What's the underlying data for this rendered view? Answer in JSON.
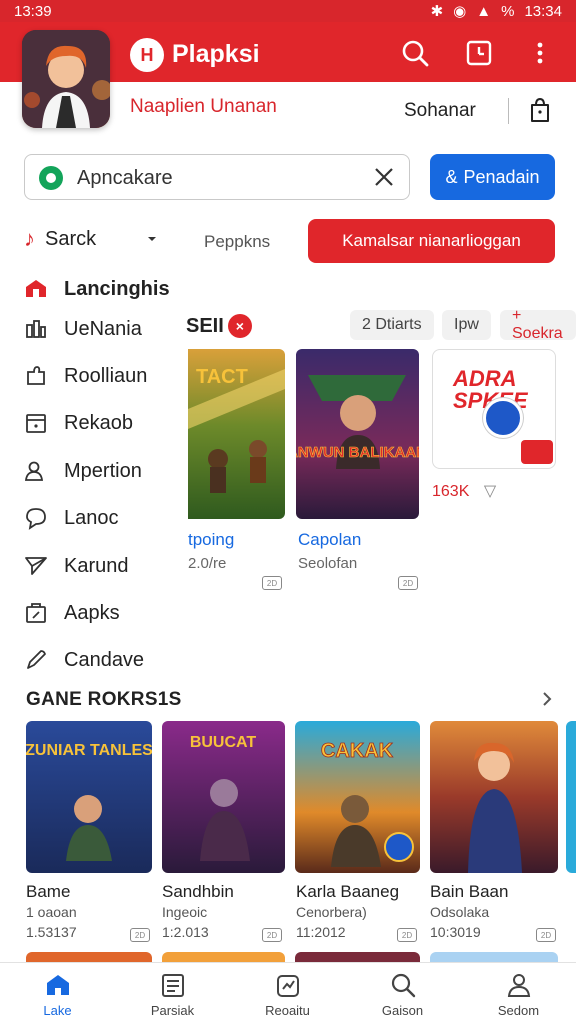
{
  "status_bar": {
    "time_left": "13:39",
    "battery": "%",
    "time_right": "13:34"
  },
  "app": {
    "title": "Plapksi",
    "logo_letter": "H",
    "subtitle": "Naaplien Unanan"
  },
  "header": {
    "sort_label": "Sohanar"
  },
  "search": {
    "value": "Apncakare",
    "button_label": "Penadain",
    "button_prefix": "&"
  },
  "filters": {
    "primary": "Sarck",
    "secondary": "Peppkns",
    "red_button": "Kamalsar nianarlioggan"
  },
  "sidebar": {
    "items": [
      {
        "label": "Lancinghis",
        "icon": "home-icon"
      },
      {
        "label": "UeNania",
        "icon": "chart-icon"
      },
      {
        "label": "Roolliaun",
        "icon": "puzzle-icon"
      },
      {
        "label": "Rekaob",
        "icon": "calendar-icon"
      },
      {
        "label": "Mpertion",
        "icon": "user-icon"
      },
      {
        "label": "Lanoc",
        "icon": "chat-icon"
      },
      {
        "label": "Karund",
        "icon": "send-icon"
      },
      {
        "label": "Aapks",
        "icon": "apps-icon"
      },
      {
        "label": "Candave",
        "icon": "pen-icon"
      }
    ]
  },
  "section": {
    "title": "SEII",
    "badge": "×",
    "chips": [
      "2 Dtiarts",
      "Ipw",
      "+ Soekra"
    ],
    "cards": [
      {
        "title": "tpoing",
        "sub": "2.0/re",
        "badge": "2D",
        "art_title": "TACT"
      },
      {
        "title": "Capolan",
        "sub": "Seolofan",
        "badge": "2D",
        "art_title": "ANWUN BALIKAAN"
      }
    ],
    "spike": {
      "art_title": "ADRA SPKEE",
      "count": "163K"
    }
  },
  "games": {
    "title": "GANE ROKRS1S",
    "items": [
      {
        "title": "Bame",
        "sub": "1 oaoan",
        "num": "1.53137",
        "badge": "2D",
        "art_title": "ZUNIAR TANLES"
      },
      {
        "title": "Sandhbin",
        "sub": "Ingeoic",
        "num": "1:2.013",
        "badge": "2D",
        "art_title": "BUUCAT"
      },
      {
        "title": "Karla Baaneg",
        "sub": "Cenorbera)",
        "num": "11:2012",
        "badge": "2D",
        "art_title": "CAKAK"
      },
      {
        "title": "Bain Baan",
        "sub": "Odsolaka",
        "num": "10:3019",
        "badge": "2D",
        "art_title": ""
      }
    ]
  },
  "bottom_nav": {
    "tabs": [
      {
        "label": "Lake",
        "icon": "home-icon"
      },
      {
        "label": "Parsiak",
        "icon": "list-icon"
      },
      {
        "label": "Reoaitu",
        "icon": "badge-icon"
      },
      {
        "label": "Gaison",
        "icon": "search-icon"
      },
      {
        "label": "Sedom",
        "icon": "profile-icon"
      }
    ]
  },
  "colors": {
    "brand_red": "#e0262b",
    "accent_blue": "#1769e0",
    "green": "#13a45a"
  }
}
